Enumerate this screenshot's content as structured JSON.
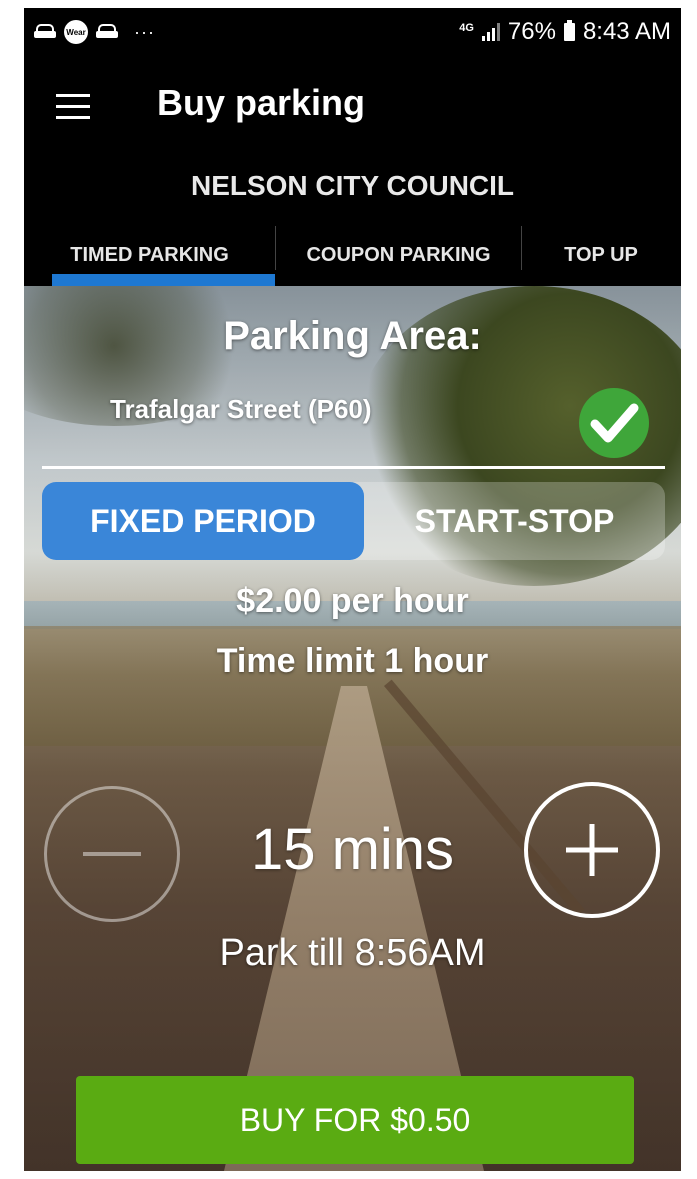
{
  "status_bar": {
    "left_icons": [
      "car-icon",
      "wear-icon",
      "car-icon",
      "more-icon"
    ],
    "wear_label": "Wear",
    "more": "···",
    "network": "4G",
    "battery_percent": "76%",
    "time": "8:43 AM"
  },
  "app_bar": {
    "title": "Buy parking",
    "menu_icon": "hamburger-menu-icon",
    "subtitle": "NELSON CITY COUNCIL"
  },
  "tabs": [
    {
      "label": "TIMED PARKING",
      "active": true
    },
    {
      "label": "COUPON PARKING",
      "active": false
    },
    {
      "label": "TOP UP",
      "active": false
    }
  ],
  "parking": {
    "area_heading": "Parking Area:",
    "area_name": "Trafalgar Street (P60)",
    "confirmed_icon": "check-circle-icon",
    "modes": {
      "fixed": "FIXED PERIOD",
      "start_stop": "START-STOP",
      "selected": "FIXED PERIOD"
    },
    "rate": "$2.00 per hour",
    "time_limit": "Time limit 1 hour",
    "duration": "15 mins",
    "park_till": "Park till 8:56AM",
    "buy_label": "BUY FOR $0.50"
  },
  "colors": {
    "accent_blue": "#1e78d2",
    "selected_mode": "#3a86d8",
    "buy_green": "#5aab12",
    "check_green": "#3fa63a",
    "app_bar_bg": "#000000"
  }
}
